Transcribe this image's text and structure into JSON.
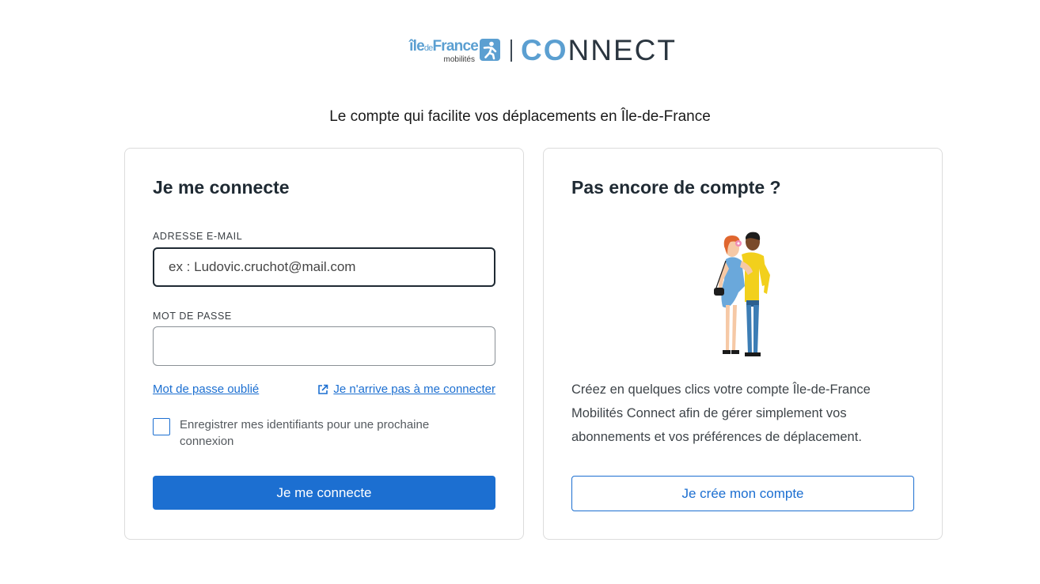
{
  "brand": {
    "idf_word_1": "île",
    "idf_word_2": "de",
    "idf_word_3": "France",
    "idf_sub": "mobilités",
    "connect_co": "CO",
    "connect_rest": "NNECT",
    "accent_color": "#5b9fd1"
  },
  "tagline": "Le compte qui facilite vos déplacements en Île-de-France",
  "login": {
    "title": "Je me connecte",
    "email_label": "ADRESSE E-MAIL",
    "email_placeholder": "ex : Ludovic.cruchot@mail.com",
    "email_value": "",
    "password_label": "MOT DE PASSE",
    "password_value": "",
    "forgot_link": "Mot de passe oublié",
    "help_link": "Je n'arrive pas à me connecter",
    "remember_label": "Enregistrer mes identifiants pour une prochaine connexion",
    "submit_label": "Je me connecte",
    "primary_color": "#1c6fd1"
  },
  "signup": {
    "title": "Pas encore de compte ?",
    "description": "Créez en quelques clics votre compte Île-de-France Mobilités Connect afin de gérer simplement vos abonnements et vos préférences de déplacement.",
    "button_label": "Je crée mon compte"
  },
  "icons": {
    "brand_icon": "walking-person-icon",
    "help_link_icon": "external-link-icon",
    "illustration": "couple-illustration"
  }
}
